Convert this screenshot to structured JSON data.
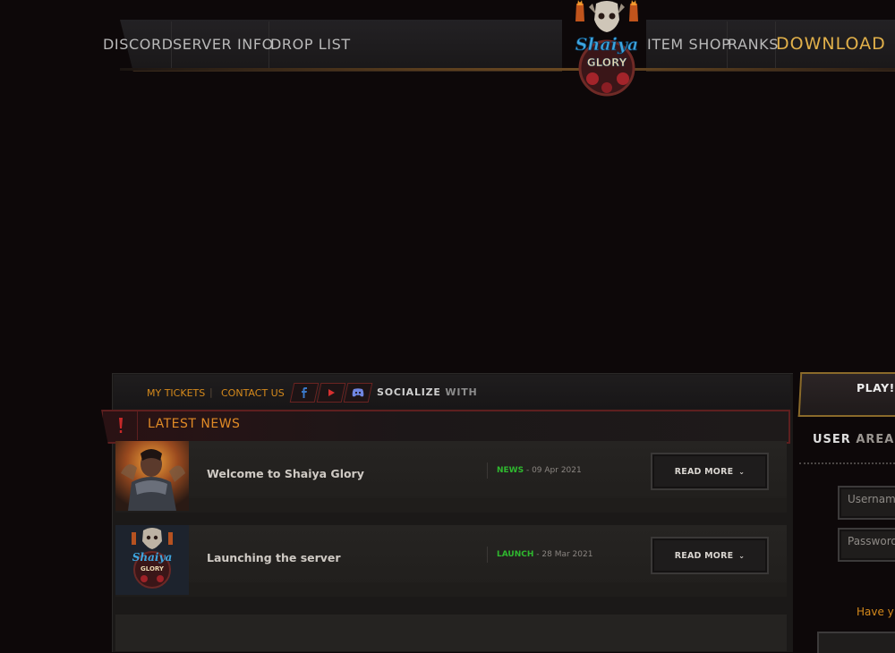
{
  "nav": {
    "left_links": [
      "DISCORD",
      "SERVER INFO",
      "DROP LIST"
    ],
    "right_links": [
      "ITEM SHOP",
      "RANKS"
    ],
    "download": "DOWNLOAD"
  },
  "logo": {
    "line1": "Shaiya",
    "line2": "GLORY"
  },
  "subbar": {
    "my_tickets": "MY TICKETS",
    "divider": "|",
    "contact_us": "CONTACT US",
    "social_icons": [
      "facebook-icon",
      "youtube-icon",
      "discord-icon"
    ],
    "socialize": "SOCIALIZE",
    "with": "WITH"
  },
  "news": {
    "title": "LATEST NEWS",
    "items": [
      {
        "headline": "Welcome to Shaiya Glory",
        "tag": "NEWS",
        "date": "- 09 Apr 2021",
        "read_more": "READ MORE"
      },
      {
        "headline": "Launching the server",
        "tag": "LAUNCH",
        "date": "- 28 Mar 2021",
        "read_more": "READ MORE"
      }
    ]
  },
  "sidebar": {
    "play": "PLAY!",
    "user_area": "USER",
    "user_area_suffix": "AREA",
    "username_placeholder": "Username",
    "password_placeholder": "Password",
    "have_account": "Have y"
  },
  "colors": {
    "accent_orange": "#d68a1c",
    "download_gold": "#e1b04a",
    "news_tag_green": "#2fb82f",
    "social_red": "#6b2422"
  }
}
